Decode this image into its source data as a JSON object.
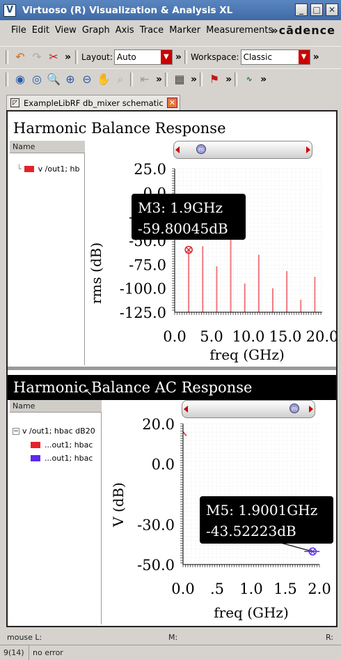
{
  "window": {
    "title": "Virtuoso (R) Visualization & Analysis XL",
    "controls": [
      "_",
      "□",
      "✕"
    ]
  },
  "menu": [
    "File",
    "Edit",
    "View",
    "Graph",
    "Axis",
    "Trace",
    "Marker",
    "Measurements"
  ],
  "brand": "»cādence",
  "toolbar1": {
    "layout_label": "Layout:",
    "layout_value": "Auto",
    "workspace_label": "Workspace:",
    "workspace_value": "Classic"
  },
  "tab": {
    "label": "ExampleLibRF db_mixer schematic"
  },
  "pane1": {
    "title": "Harmonic Balance Response",
    "name_header": "Name",
    "trace_label": "v /out1; hb",
    "marker": {
      "line1": "M3: 1.9GHz",
      "line2": "-59.80045dB"
    }
  },
  "pane2": {
    "title": "Harmonic Balance AC Response",
    "name_header": "Name",
    "tree_root": "v /out1; hbac dB20",
    "tree_children": [
      "...out1; hbac",
      "...out1; hbac"
    ],
    "marker": {
      "line1": "M5: 1.9001GHz",
      "line2": "-43.52223dB"
    }
  },
  "colors": {
    "trace_red": "#e8202b",
    "trace_blue": "#5a2cf0",
    "accent_title": "#3f6aa6"
  },
  "chart_data": [
    {
      "type": "bar",
      "title": "Harmonic Balance Response",
      "xlabel": "freq (GHz)",
      "ylabel": "rms (dB)",
      "xticks": [
        "0.0",
        "5.0",
        "10.0",
        "15.0",
        "20.0"
      ],
      "yticks": [
        "25.0",
        "0.0",
        "-25.0",
        "-50.0",
        "-75.0",
        "-100.0",
        "-125.0"
      ],
      "xlim": [
        0,
        20
      ],
      "ylim": [
        -125,
        25
      ],
      "grid": true,
      "series": [
        {
          "name": "v /out1; hb",
          "x": [
            1.9,
            3.8,
            5.7,
            7.6,
            9.5,
            11.4,
            13.3,
            15.2,
            17.1,
            19.0
          ],
          "values": [
            -59.8,
            -56,
            -77,
            -40,
            -95,
            -65,
            -100,
            -82,
            -112,
            -88
          ]
        }
      ]
    },
    {
      "type": "line",
      "title": "Harmonic Balance AC Response",
      "xlabel": "freq (GHz)",
      "ylabel": "V (dB)",
      "xticks": [
        "0.0",
        ".5",
        "1.0",
        "1.5",
        "2.0"
      ],
      "yticks": [
        "20.0",
        "0.0",
        "-30.0",
        "-50.0"
      ],
      "xlim": [
        0,
        2.0
      ],
      "ylim": [
        -50,
        20
      ],
      "grid": true,
      "series": [
        {
          "x": [
            0.0,
            0.05
          ],
          "values": [
            16.0,
            14.0
          ]
        },
        {
          "x": [
            1.3,
            1.9001
          ],
          "values": [
            -38.0,
            -43.52
          ]
        }
      ]
    }
  ],
  "status": {
    "mouse_l": "mouse L:",
    "m": "M:",
    "r": "R:",
    "count": "9(14)",
    "message": "no error"
  }
}
